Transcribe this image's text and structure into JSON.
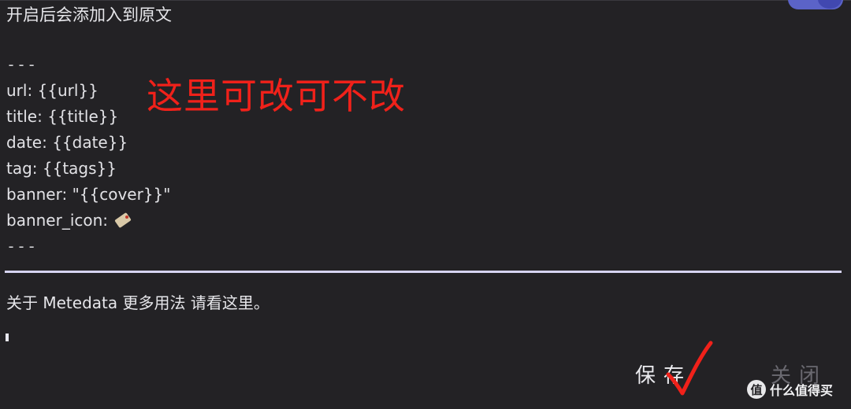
{
  "editor": {
    "hint": "开启后会添加入到原文",
    "yaml_lines": [
      "---",
      "url: {{url}}",
      "title: {{title}}",
      "date: {{date}}",
      "tag: {{tags}}",
      "banner: \"{{cover}}\"",
      "banner_icon: ",
      "---"
    ],
    "banner_icon_emoji": "tag-emoji",
    "meta_link": "关于 Metedata 更多用法 请看这里。"
  },
  "annotation": {
    "text": "这里可改可不改",
    "color": "#f0211a"
  },
  "toggle": {
    "state": "on",
    "color": "#5b63c8"
  },
  "buttons": {
    "save": "保存",
    "close": "关闭"
  },
  "watermark": {
    "icon": "值",
    "text": "什么值得买"
  }
}
